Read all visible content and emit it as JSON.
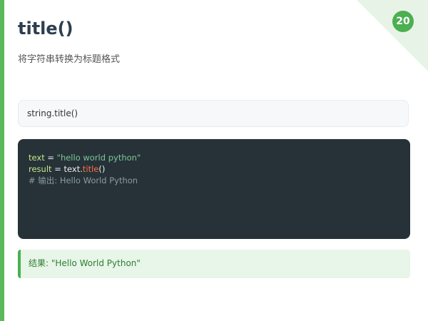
{
  "slide": {
    "number": "20",
    "title": "title()",
    "subtitle": "将字符串转换为标题格式"
  },
  "syntax": "string.title()",
  "code": {
    "line1": {
      "var": "text",
      "op": " = ",
      "str": "\"hello world python\""
    },
    "line2": {
      "var": "result",
      "op": " = ",
      "obj": "text.",
      "method": "title",
      "call": "()"
    },
    "line3": {
      "comment": "# 输出: Hello World Python"
    }
  },
  "result": "结果: \"Hello World Python\"",
  "colors": {
    "accent": "#4caf50",
    "code_bg": "#263238",
    "string": "#7ec699",
    "method": "#ff7043",
    "comment": "#8b9ba3"
  }
}
